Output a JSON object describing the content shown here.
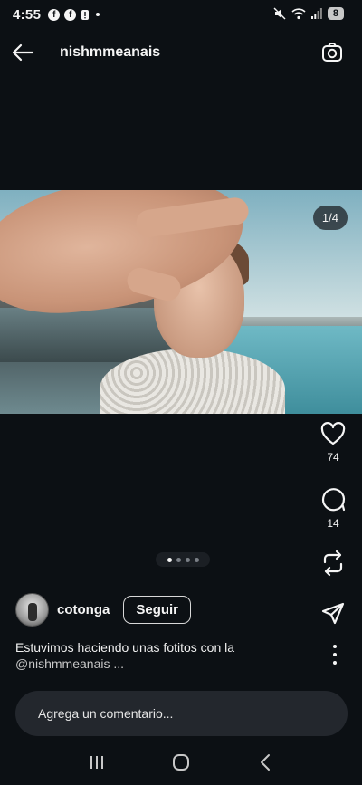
{
  "status_bar": {
    "time": "4:55",
    "battery": "8"
  },
  "header": {
    "username": "nishmmeanais"
  },
  "media": {
    "counter": "1/4"
  },
  "actions": {
    "likes": "74",
    "comments": "14"
  },
  "carousel": {
    "total": 4,
    "active": 0
  },
  "post": {
    "author": "cotonga",
    "follow_label": "Seguir",
    "caption_text": "Estuvimos haciendo unas fotitos con la",
    "caption_mention": "@nishmmeanais ..."
  },
  "comment": {
    "placeholder": "Agrega un comentario..."
  },
  "icons": {
    "back": "arrow-left-icon",
    "camera": "camera-icon",
    "like": "heart-icon",
    "comment": "comment-icon",
    "repost": "repost-icon",
    "share": "send-icon",
    "more": "more-vertical-icon"
  },
  "colors": {
    "background": "#0c1014",
    "comment_bg": "#23272d"
  }
}
